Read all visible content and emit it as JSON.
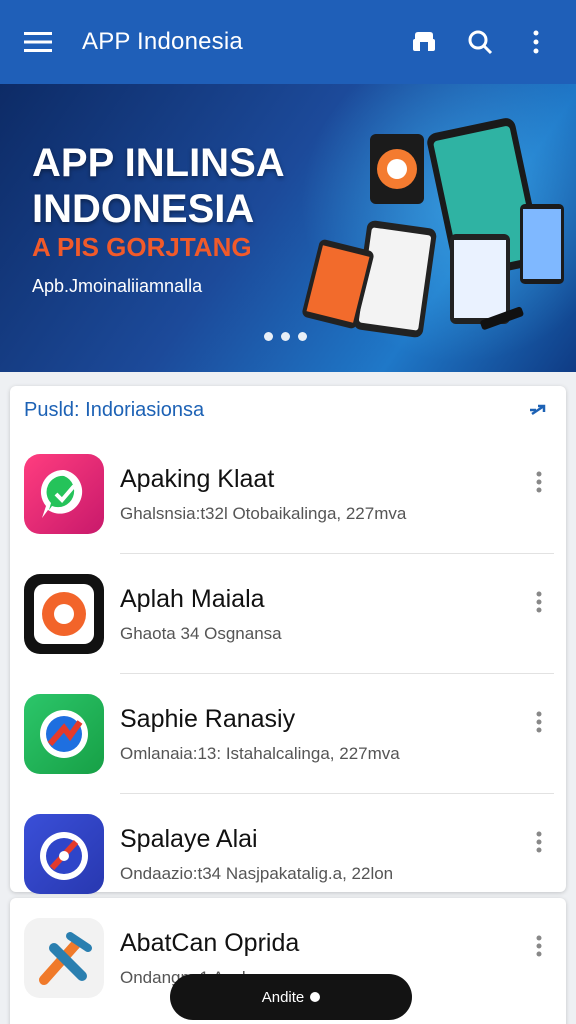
{
  "app_bar": {
    "title": "APP Indonesia",
    "icons": [
      "menu-icon",
      "store-icon",
      "search-icon",
      "more-vert-icon"
    ]
  },
  "banner": {
    "headline_line1": "APP INLINSA",
    "headline_line2": "INDONESIA",
    "subheadline": "A PIS GORJTANG",
    "tagline": "Apb.Jmoinaliiamnalla",
    "carousel_dots": 3
  },
  "section": {
    "title": "Pusld: Indoriasionsa",
    "expand_icon": "expand-icon"
  },
  "apps": [
    {
      "name": "Apaking Klaat",
      "meta": "Ghalsnsia:t32l Otobaikalinga, 227mva",
      "icon": "green-chat-icon"
    },
    {
      "name": "Aplah Maiala",
      "meta": "Ghaota 34 Osgnansa",
      "icon": "orange-circle-icon"
    },
    {
      "name": "Saphie Ranasiy",
      "meta": "Omlanaia:13: Istahalcalinga, 227mva",
      "icon": "red-blue-arrow-icon"
    },
    {
      "name": "Spalaye Alai",
      "meta": "Ondaazio:t34 Nasjpakatalig.a, 22lon",
      "icon": "blue-compass-icon"
    },
    {
      "name": "AbatCan Oprida",
      "meta": "Ondangm:1 Aacka",
      "icon": "hammer-icon"
    }
  ],
  "snackbar": {
    "label": "Andite"
  },
  "colors": {
    "primary": "#1f5fb8",
    "accent": "#f15a2a",
    "section_title": "#1d62b5"
  }
}
